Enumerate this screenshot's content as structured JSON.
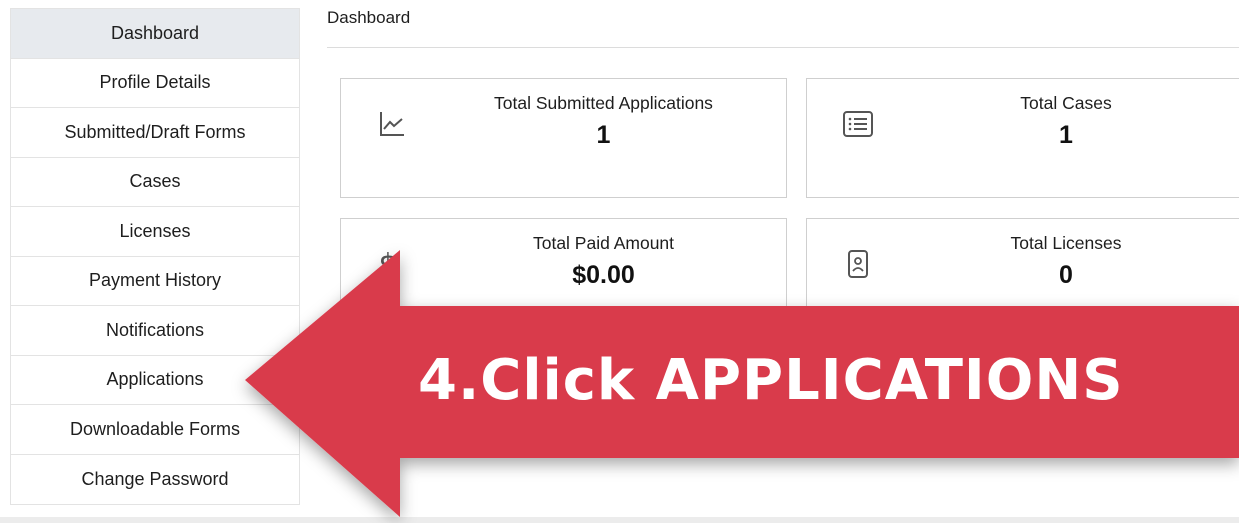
{
  "sidebar": {
    "items": [
      {
        "label": "Dashboard",
        "active": true
      },
      {
        "label": "Profile Details"
      },
      {
        "label": "Submitted/Draft Forms"
      },
      {
        "label": "Cases"
      },
      {
        "label": "Licenses"
      },
      {
        "label": "Payment History"
      },
      {
        "label": "Notifications"
      },
      {
        "label": "Applications"
      },
      {
        "label": "Downloadable Forms"
      },
      {
        "label": "Change Password"
      }
    ]
  },
  "main": {
    "title": "Dashboard",
    "cards": [
      {
        "label": "Total Submitted Applications",
        "value": "1",
        "icon": "line-chart-icon"
      },
      {
        "label": "Total Cases",
        "value": "1",
        "icon": "list-icon"
      },
      {
        "label": "Total Paid Amount",
        "value": "$0.00",
        "icon": "dollar-icon"
      },
      {
        "label": "Total Licenses",
        "value": "0",
        "icon": "id-badge-icon"
      }
    ]
  },
  "annotation": {
    "text": "4.Click APPLICATIONS",
    "color": "#d93a4c"
  }
}
